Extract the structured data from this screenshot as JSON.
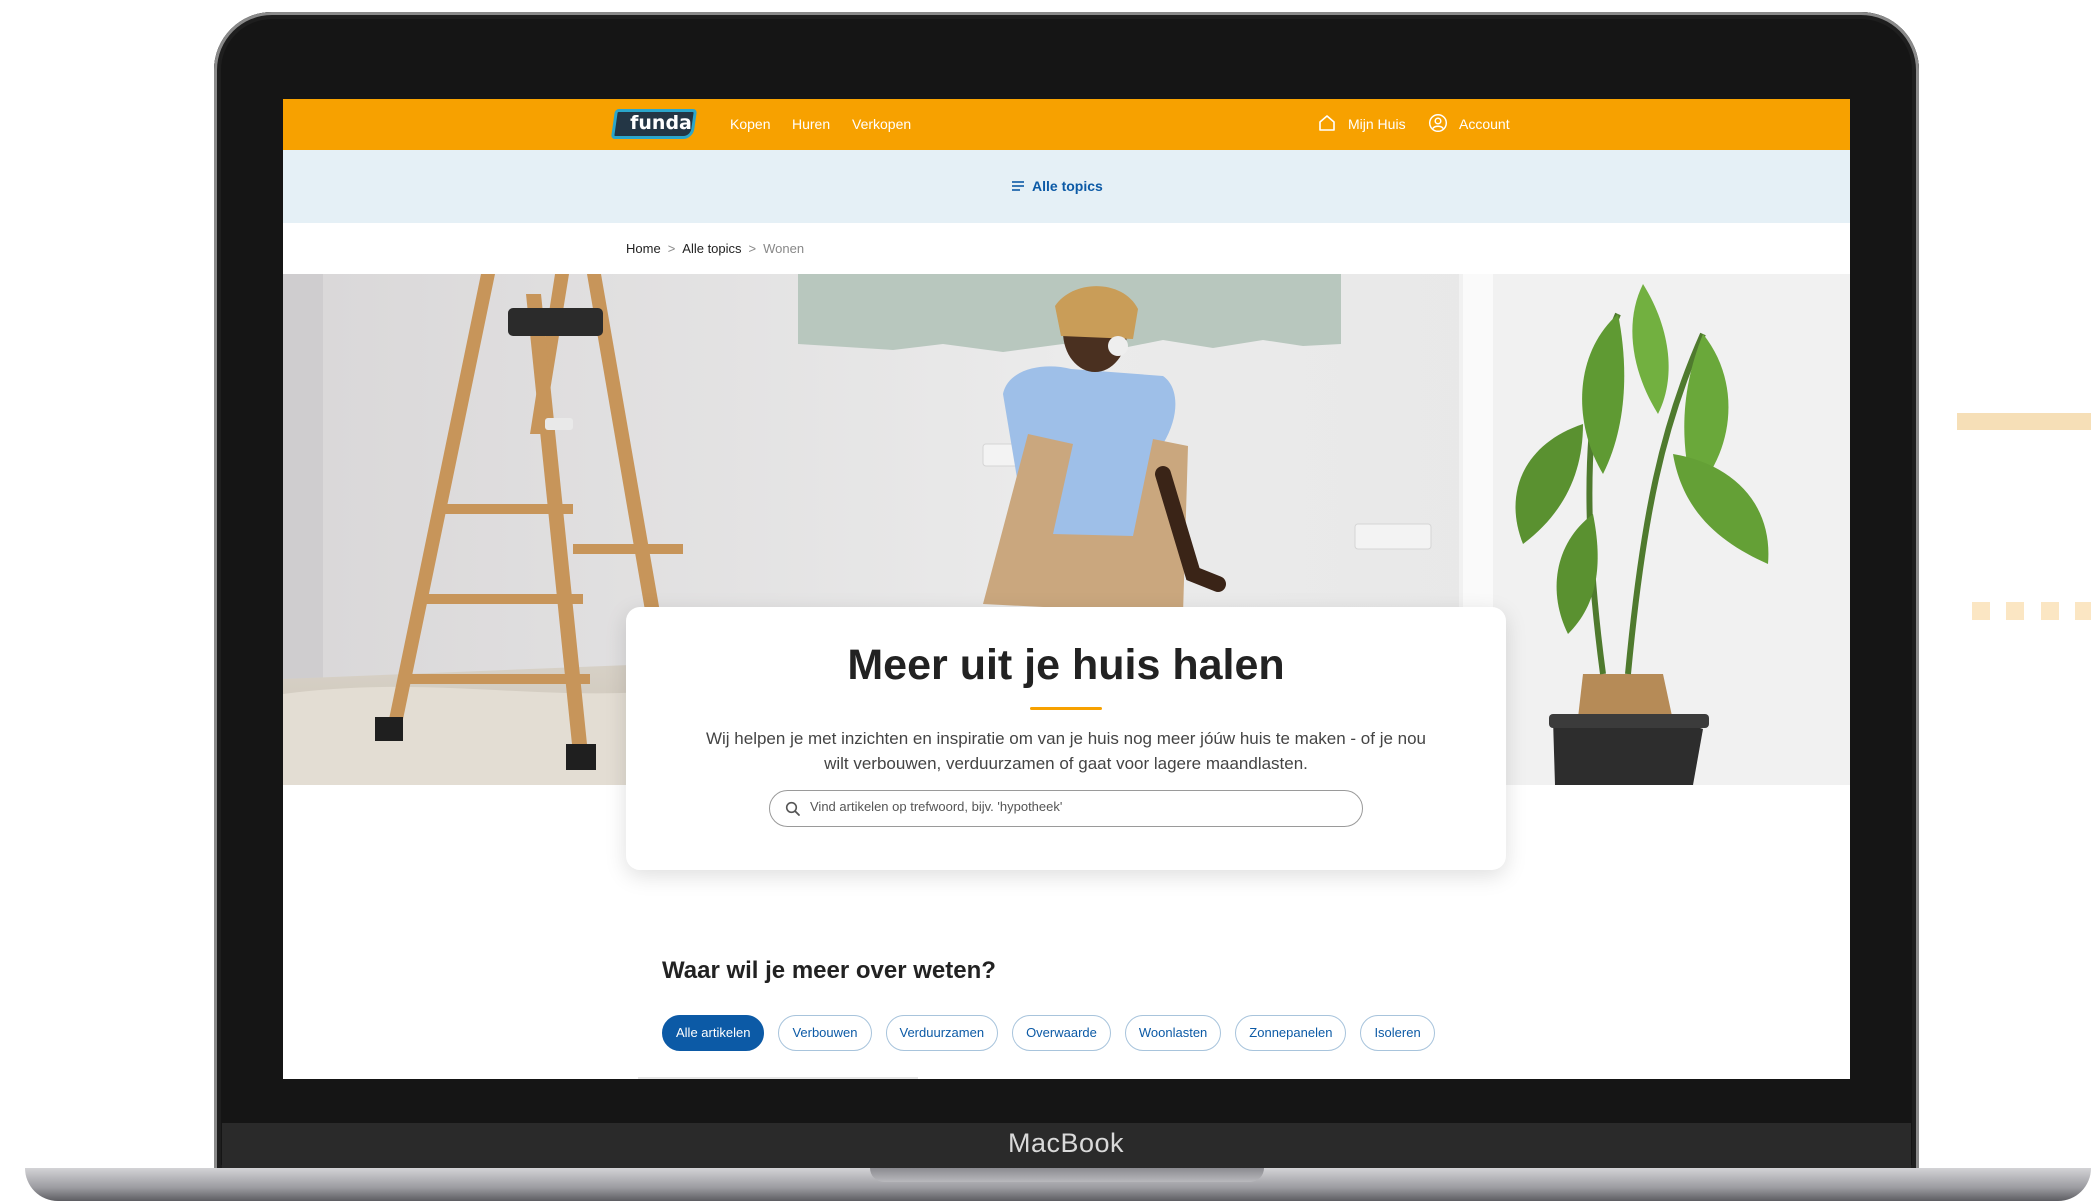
{
  "device": {
    "brand_label": "MacBook"
  },
  "header": {
    "logo_text": "funda",
    "nav": [
      "Kopen",
      "Huren",
      "Verkopen"
    ],
    "mijn_huis": "Mijn Huis",
    "account": "Account"
  },
  "topics_bar": {
    "label": "Alle topics"
  },
  "breadcrumb": {
    "home": "Home",
    "sep": ">",
    "topics": "Alle topics",
    "current": "Wonen"
  },
  "hero_card": {
    "title": "Meer uit je huis halen",
    "description": "Wij helpen je met inzichten en inspiratie om van je huis nog meer jóúw huis te maken - of je nou wilt verbouwen, verduurzamen of gaat voor lagere maandlasten.",
    "search_placeholder": "Vind artikelen op trefwoord, bijv. 'hypotheek'"
  },
  "topics_section": {
    "title": "Waar wil je meer over weten?",
    "chips": [
      "Alle artikelen",
      "Verbouwen",
      "Verduurzamen",
      "Overwaarde",
      "Woonlasten",
      "Zonnepanelen",
      "Isoleren"
    ],
    "active_chip": "Alle artikelen"
  },
  "icons": [
    "home-icon",
    "user-circle-icon",
    "menu-lines-icon",
    "search-icon"
  ],
  "colors": {
    "brand_orange": "#f7a100",
    "link_blue": "#0c5aa6",
    "topics_bar_bg": "#e5f0f6"
  }
}
